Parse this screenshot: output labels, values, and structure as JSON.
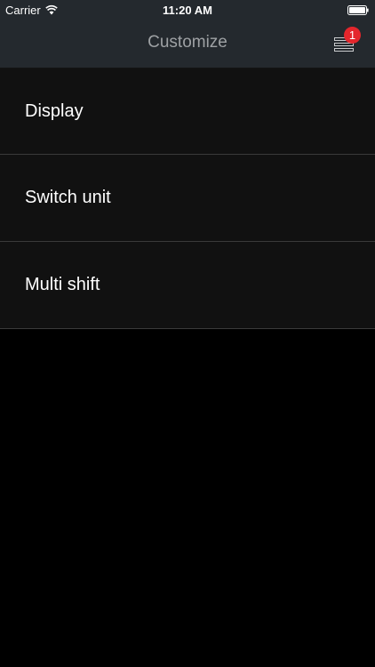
{
  "status_bar": {
    "carrier": "Carrier",
    "time": "11:20 AM",
    "icons": [
      "wifi-icon",
      "battery-icon"
    ]
  },
  "nav": {
    "title": "Customize",
    "menu_icon": "hamburger-menu-icon",
    "badge_count": "1"
  },
  "menu": {
    "items": [
      {
        "label": "Display"
      },
      {
        "label": "Switch unit"
      },
      {
        "label": "Multi shift"
      }
    ]
  },
  "colors": {
    "background": "#000000",
    "bar_background": "#24292e",
    "title_color": "#9ea1a4",
    "list_background": "#111111",
    "separator": "#3a3a3a",
    "badge": "#e4262c"
  }
}
